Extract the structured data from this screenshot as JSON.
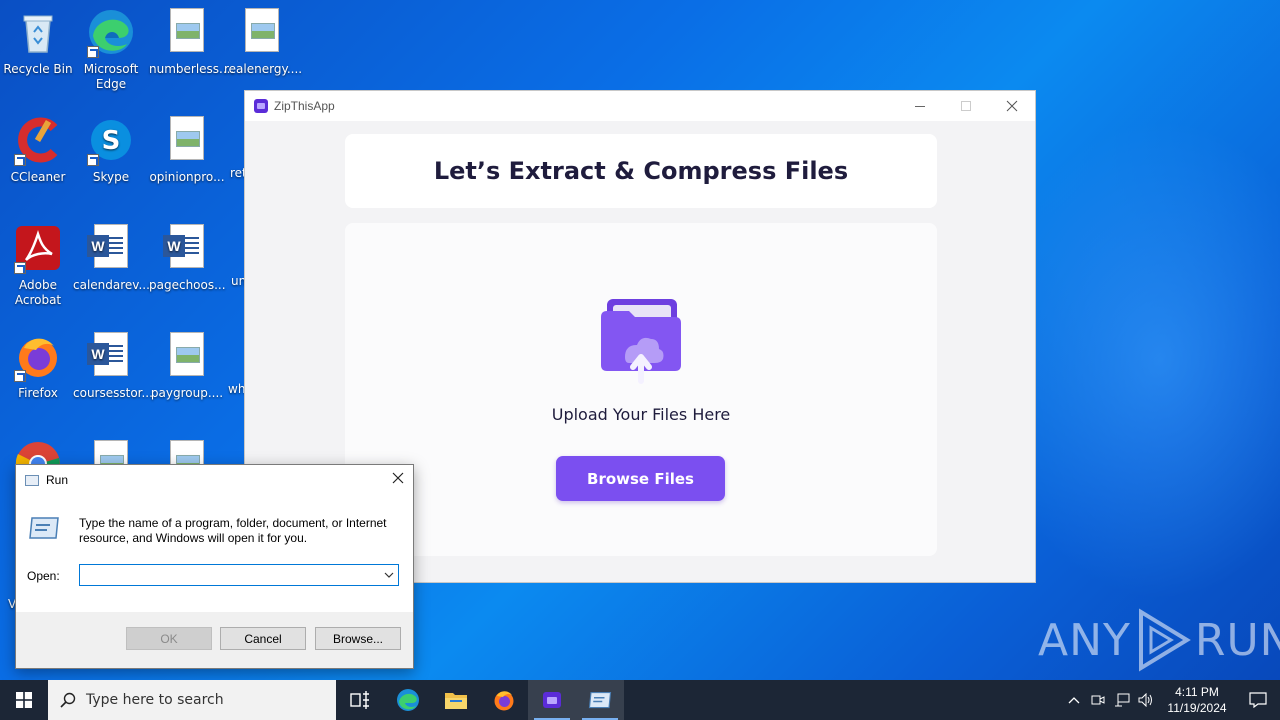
{
  "desktop": {
    "icons": [
      {
        "label": "Recycle Bin"
      },
      {
        "label": "Microsoft Edge"
      },
      {
        "label": "numberless...."
      },
      {
        "label": "realenergy...."
      },
      {
        "label": "CCleaner"
      },
      {
        "label": "Skype"
      },
      {
        "label": "opinionpro..."
      },
      {
        "label": "ret"
      },
      {
        "label": "Adobe Acrobat"
      },
      {
        "label": "calendarev..."
      },
      {
        "label": "pagechoos..."
      },
      {
        "label": "un"
      },
      {
        "label": "Firefox"
      },
      {
        "label": "coursesstor..."
      },
      {
        "label": "paygroup...."
      },
      {
        "label": "wh"
      },
      {
        "label": "V"
      }
    ]
  },
  "app_window": {
    "title": "ZipThisApp",
    "heading": "Let’s Extract & Compress Files",
    "upload_text": "Upload Your Files Here",
    "browse_label": "Browse Files",
    "accent_color": "#7b4ff0"
  },
  "run_dialog": {
    "title": "Run",
    "description": "Type the name of a program, folder, document, or Internet resource, and Windows will open it for you.",
    "open_label": "Open:",
    "open_value": "",
    "ok_label": "OK",
    "cancel_label": "Cancel",
    "browse_label": "Browse..."
  },
  "watermark": {
    "text_left": "ANY",
    "text_right": "RUN"
  },
  "taskbar": {
    "search_placeholder": "Type here to search",
    "time": "4:11 PM",
    "date": "11/19/2024"
  }
}
